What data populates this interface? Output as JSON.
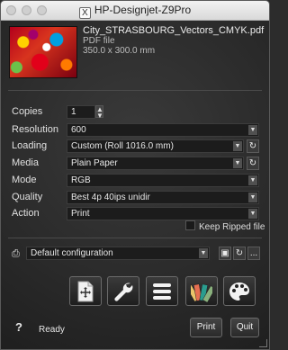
{
  "window": {
    "title": "HP-Designjet-Z9Pro",
    "app_icon": "x11-icon"
  },
  "file": {
    "name": "City_STRASBOURG_Vectors_CMYK.pdf",
    "type": "PDF file",
    "size": "350.0 x 300.0 mm"
  },
  "settings": {
    "copies_label": "Copies",
    "copies_value": "1",
    "resolution_label": "Resolution",
    "resolution_value": "600",
    "loading_label": "Loading",
    "loading_value": "Custom (Roll 1016.0 mm)",
    "media_label": "Media",
    "media_value": "Plain Paper",
    "mode_label": "Mode",
    "mode_value": "RGB",
    "quality_label": "Quality",
    "quality_value": "Best 4p 40ips unidir",
    "action_label": "Action",
    "action_value": "Print",
    "keep_ripped_label": "Keep Ripped file",
    "more_label": "..."
  },
  "configuration": {
    "value": "Default configuration"
  },
  "toolbar": {
    "icons": [
      "page-layout-icon",
      "wrench-icon",
      "list-icon",
      "color-swatches-icon",
      "palette-icon"
    ]
  },
  "status": {
    "help_label": "?",
    "text": "Ready"
  },
  "buttons": {
    "print": "Print",
    "quit": "Quit"
  }
}
